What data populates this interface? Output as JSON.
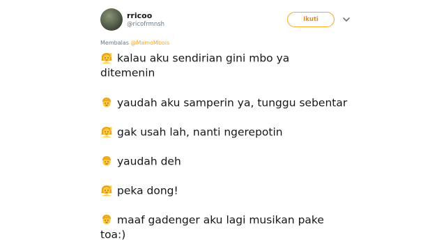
{
  "tweet": {
    "display_name": "rricoo",
    "handle": "@ricofrmnsh",
    "follow_label": "Ikuti",
    "reply_prefix": "Membalas",
    "reply_mention": "@MamoMbois",
    "lines": [
      {
        "emoji": "woman-raising-hand-emoji",
        "text": "kalau aku sendirian gini mbo ya"
      },
      {
        "emoji": "",
        "text": "ditemenin"
      },
      {
        "emoji": "man-emoji",
        "text": "yaudah aku samperin ya, tunggu sebentar"
      },
      {
        "emoji": "woman-raising-hand-emoji",
        "text": "gak usah lah, nanti ngerepotin"
      },
      {
        "emoji": "man-emoji",
        "text": "yaudah deh"
      },
      {
        "emoji": "woman-raising-hand-emoji",
        "text": "peka dong!"
      },
      {
        "emoji": "man-emoji",
        "text": "maaf gadenger aku lagi musikan pake"
      },
      {
        "emoji": "",
        "text": "toa:)"
      }
    ]
  },
  "colors": {
    "accent": "#f5a623",
    "emoji_skin": "#ffc83d",
    "muted": "#657786"
  }
}
